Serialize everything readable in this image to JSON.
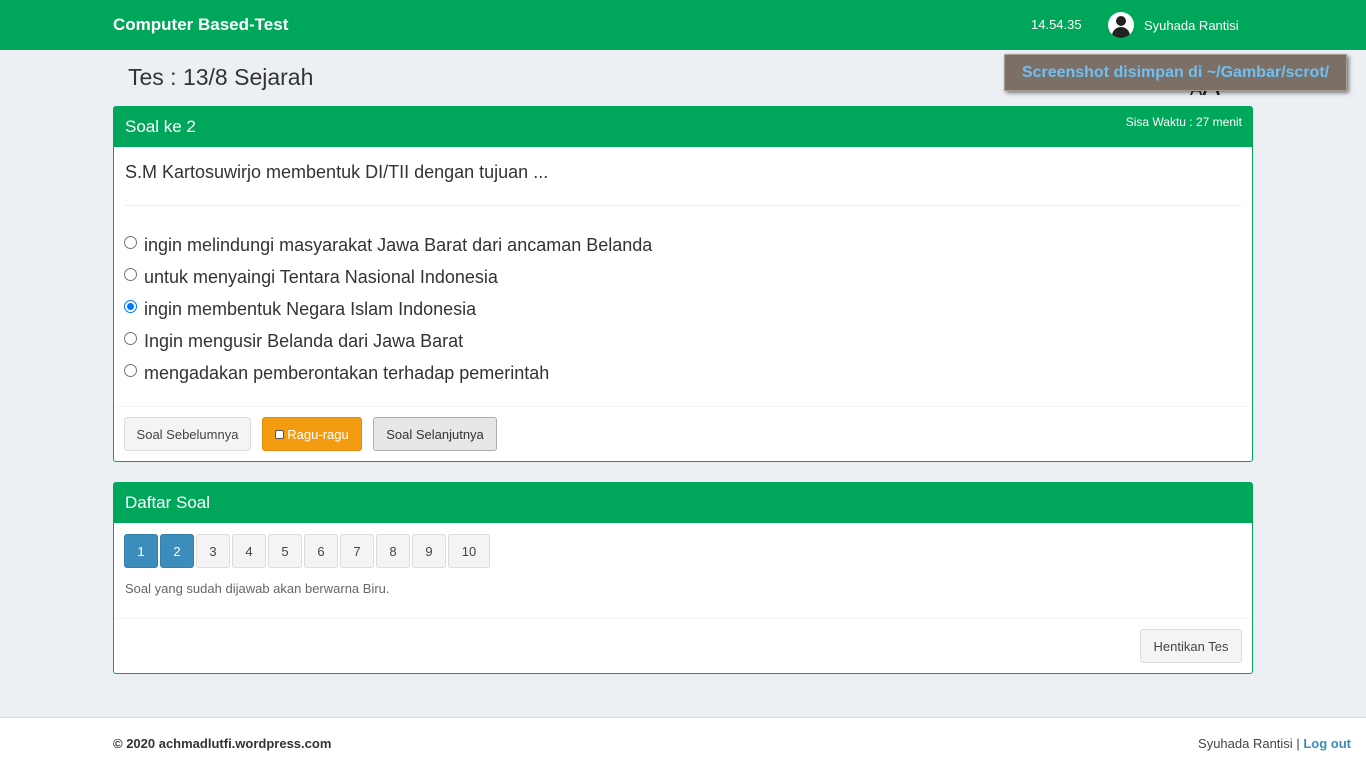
{
  "navbar": {
    "brand": "Computer Based-Test",
    "clock": "14.54.35",
    "user_name": "Syuhada Rantisi"
  },
  "page": {
    "title": "Tes : 13/8 Sejarah",
    "font_size_icon": "A",
    "font_size_icon_small": "A"
  },
  "notification": {
    "text": "Screenshot disimpan di ~/Gambar/scrot/"
  },
  "question_box": {
    "title": "Soal ke 2",
    "timer": "Sisa Waktu : 27 menit",
    "question": "S.M Kartosuwirjo membentuk DI/TII dengan tujuan ...",
    "options": [
      {
        "label": "ingin melindungi masyarakat Jawa Barat dari ancaman Belanda",
        "checked": false
      },
      {
        "label": "untuk menyaingi Tentara Nasional Indonesia",
        "checked": false
      },
      {
        "label": "ingin membentuk Negara Islam Indonesia",
        "checked": true
      },
      {
        "label": "Ingin mengusir Belanda dari Jawa Barat",
        "checked": false
      },
      {
        "label": "mengadakan pemberontakan terhadap pemerintah",
        "checked": false
      }
    ],
    "prev_label": "Soal Sebelumnya",
    "ragu_label": "Ragu-ragu",
    "next_label": "Soal Selanjutnya"
  },
  "list_box": {
    "title": "Daftar Soal",
    "numbers": [
      {
        "label": "1",
        "answered": true
      },
      {
        "label": "2",
        "answered": true
      },
      {
        "label": "3",
        "answered": false
      },
      {
        "label": "4",
        "answered": false
      },
      {
        "label": "5",
        "answered": false
      },
      {
        "label": "6",
        "answered": false
      },
      {
        "label": "7",
        "answered": false
      },
      {
        "label": "8",
        "answered": false
      },
      {
        "label": "9",
        "answered": false
      },
      {
        "label": "10",
        "answered": false
      }
    ],
    "hint": "Soal yang sudah dijawab akan berwarna Biru.",
    "stop_label": "Hentikan Tes"
  },
  "footer": {
    "copyright": "© 2020 achmadlutfi.wordpress.com",
    "user_name": "Syuhada Rantisi",
    "separator": "|",
    "logout_label": "Log out"
  },
  "colors": {
    "primary_green": "#00a65a",
    "answered_blue": "#3c8dbc",
    "ragu_orange": "#f39c12"
  }
}
